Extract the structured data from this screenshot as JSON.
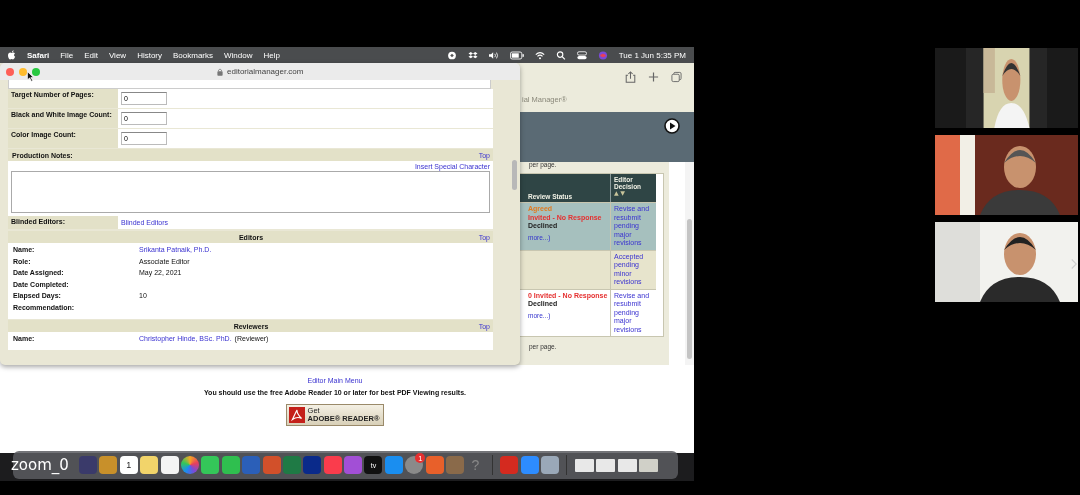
{
  "menu_bar": {
    "app": "Safari",
    "menus": [
      "File",
      "Edit",
      "View",
      "History",
      "Bookmarks",
      "Window",
      "Help"
    ],
    "clock": "Tue 1 Jun  5:35 PM"
  },
  "background_window": {
    "brand_fragment": "ial Manager®",
    "per_page_top": "per page.",
    "table": {
      "columns": [
        "Review Status",
        "Editor Decision"
      ],
      "rows": [
        {
          "selected": true,
          "statuses": [
            {
              "text": "Agreed",
              "color": "#e07a20"
            },
            {
              "text": "Invited - No Response",
              "color": "#e53030"
            },
            {
              "text": "Declined"
            }
          ],
          "more": "more...)",
          "decision": "Revise and resubmit pending major revisions"
        },
        {
          "selected": false,
          "statuses": [],
          "decision": "Accepted pending minor revisions"
        },
        {
          "selected": false,
          "statuses": [
            {
              "text": "0 Invited - No Response",
              "color": "#e53030"
            },
            {
              "text": "Declined"
            }
          ],
          "more": "more...)",
          "decision": "Revise and resubmit pending major revisions"
        }
      ]
    },
    "per_page_bottom": "per page.",
    "main_menu_link": "Editor Main Menu",
    "pdf_note": "You should use the free Adobe Reader 10 or later for best PDF Viewing results.",
    "adobe_button": {
      "line1": "Get",
      "line2": "ADOBE® READER®"
    }
  },
  "popup_window": {
    "url": "editorialmanager.com",
    "fields": [
      {
        "label": "Target Number of Pages:",
        "value": "0"
      },
      {
        "label": "Black and White Image Count:",
        "value": "0"
      },
      {
        "label": "Color Image Count:",
        "value": "0"
      }
    ],
    "production_notes": {
      "label": "Production Notes:",
      "top_link": "Top",
      "insert_link": "Insert Special Character"
    },
    "blinded_editors": {
      "label": "Blinded Editors:",
      "link": "Blinded Editors"
    },
    "editors": {
      "title": "Editors",
      "top_link": "Top",
      "rows": [
        {
          "label": "Name:",
          "value": "Srikanta Patnaik, Ph.D.",
          "kind": "link"
        },
        {
          "label": "Role:",
          "value": "Associate Editor",
          "kind": "text"
        },
        {
          "label": "Date Assigned:",
          "value": "May 22, 2021",
          "kind": "text"
        },
        {
          "label": "Date Completed:",
          "kind": "text"
        },
        {
          "label": "Elapsed Days:",
          "value": "10",
          "kind": "text"
        },
        {
          "label": "Recommendation:",
          "kind": "text"
        }
      ]
    },
    "reviewers": {
      "title": "Reviewers",
      "top_link": "Top",
      "rows": [
        {
          "label": "Name:",
          "value": "Christopher Hinde, BSc. PhD.",
          "note": "(Reviewer)",
          "kind": "link"
        }
      ]
    }
  },
  "dock": {
    "calendar_day": "1",
    "tv_label": "tv",
    "notification_badge": "1",
    "unknown_app_glyph": "?"
  },
  "overlay_label": "zoom_0"
}
